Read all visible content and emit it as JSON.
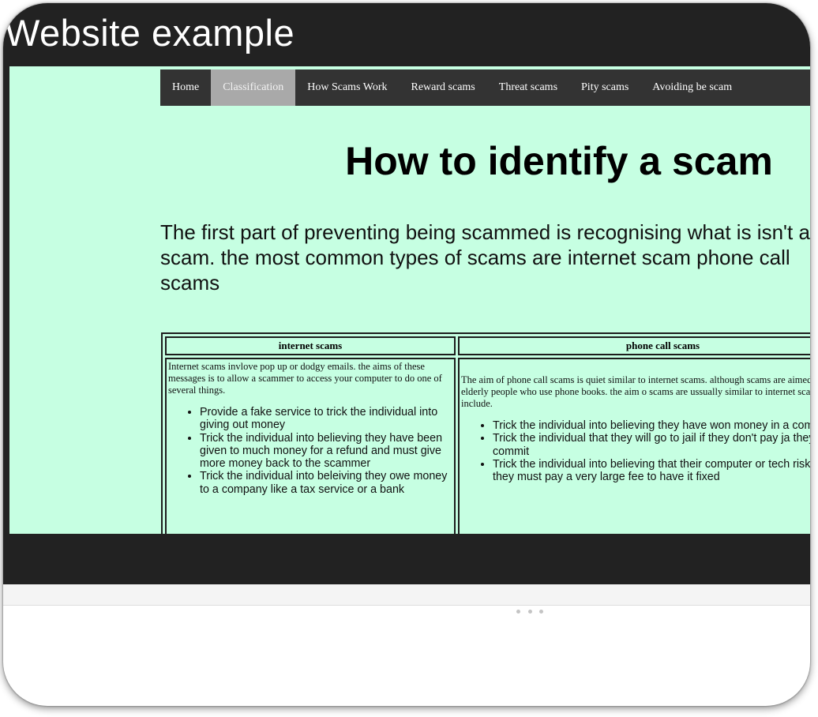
{
  "slide": {
    "title": "Website example"
  },
  "nav": {
    "items": [
      {
        "label": "Home",
        "active": false
      },
      {
        "label": "Classification",
        "active": true
      },
      {
        "label": "How Scams Work",
        "active": false
      },
      {
        "label": "Reward scams",
        "active": false
      },
      {
        "label": "Threat scams",
        "active": false
      },
      {
        "label": "Pity scams",
        "active": false
      },
      {
        "label": "Avoiding be scam",
        "active": false
      }
    ]
  },
  "page": {
    "heading": "How to identify a scam",
    "intro": "The first part of preventing being scammed is recognising what is isn't a scam. the most common types of scams are internet scam phone call scams"
  },
  "table": {
    "headers": [
      "internet scams",
      "phone call scams"
    ],
    "internet": {
      "intro": "Internet scams invlove pop up or dodgy emails. the aims of these messages is to allow a scammer to access your computer to do one of several things.",
      "bullets": [
        "Provide a fake service to trick the individual into giving out money",
        "Trick the individual into believing they have been given to much money for a refund and must give more money back to the scammer",
        "Trick the individual into beleiving they owe money to a company like a tax service or a bank"
      ]
    },
    "phone": {
      "intro": "The aim of phone call scams is quiet similar to internet scams. although scams are aimed towards elderly people who use phone books. the aim o scams are ussually similar to internet scams but include.",
      "bullets": [
        "Trick the individual into believing they have won money in a comeption",
        "Trick the individual that they will go to jail if they don't pay ja they didnt commit",
        "Trick the individual into believing that their computer or tech risk and that they must pay a very large fee to have it fixed"
      ]
    }
  },
  "colors": {
    "slide_background": "#222222",
    "site_background": "#c6ffe2",
    "nav_background": "#333333",
    "nav_active": "#a9a9a9"
  }
}
